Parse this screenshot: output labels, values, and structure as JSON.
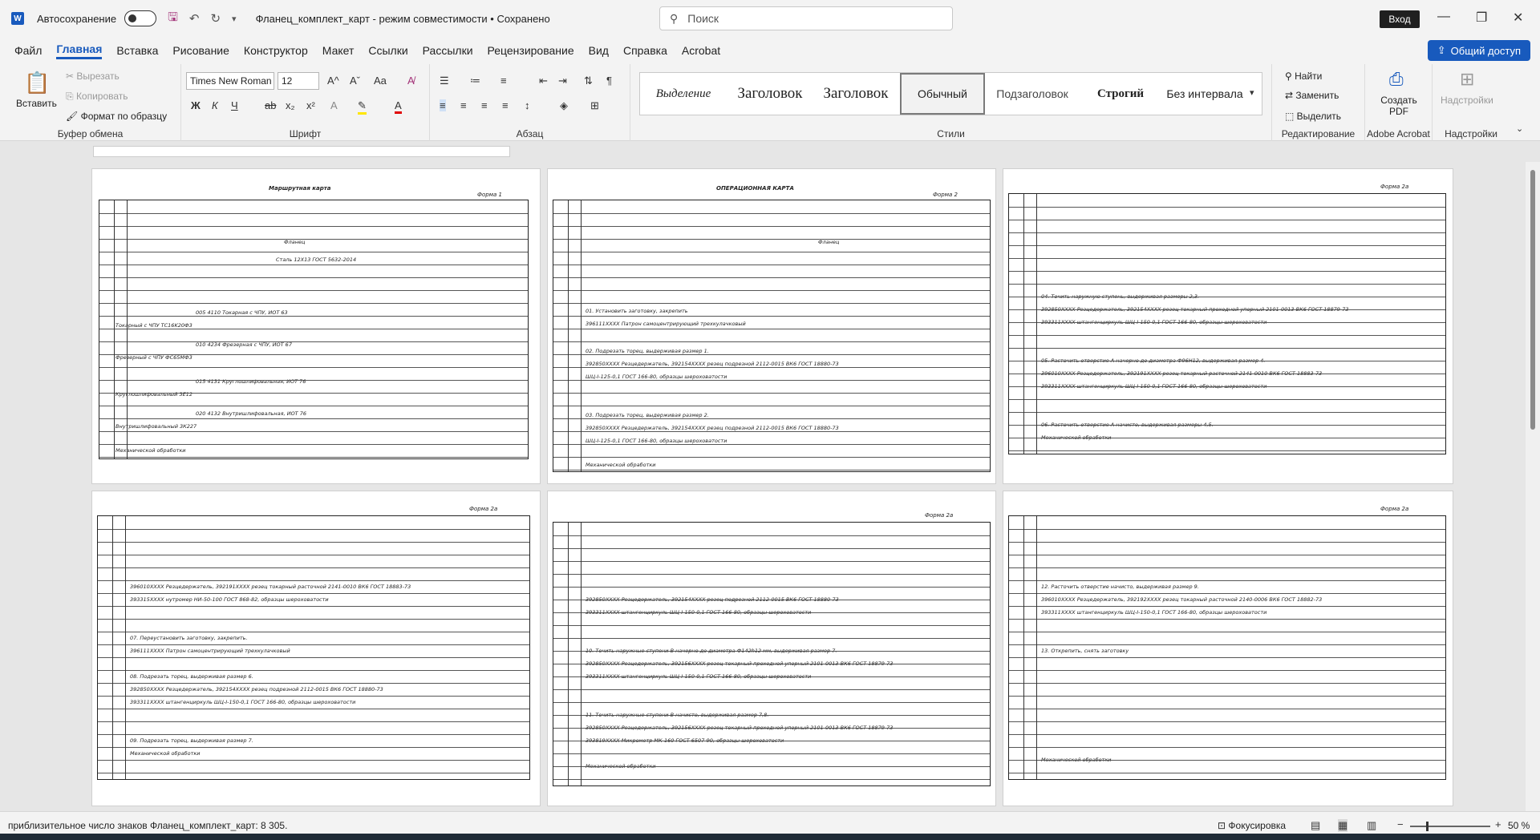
{
  "titlebar": {
    "autosave_label": "Автосохранение",
    "document_title": "Фланец_комплект_карт - режим совместимости • Сохранено",
    "search_placeholder": "Поиск",
    "login_label": "Вход"
  },
  "menu": {
    "items": [
      "Файл",
      "Главная",
      "Вставка",
      "Рисование",
      "Конструктор",
      "Макет",
      "Ссылки",
      "Рассылки",
      "Рецензирование",
      "Вид",
      "Справка",
      "Acrobat"
    ],
    "active": "Главная",
    "share_label": "Общий доступ"
  },
  "ribbon": {
    "clipboard": {
      "paste": "Вставить",
      "cut": "Вырезать",
      "copy": "Копировать",
      "format_painter": "Формат по образцу",
      "group_label": "Буфер обмена"
    },
    "font": {
      "font_name": "Times New Roman",
      "font_size": "12",
      "group_label": "Шрифт"
    },
    "paragraph": {
      "group_label": "Абзац"
    },
    "styles": {
      "items": [
        "Выделение",
        "Заголовок",
        "Заголовок",
        "Обычный",
        "Подзаголовок",
        "Строгий",
        "Без интервала"
      ],
      "group_label": "Стили"
    },
    "editing": {
      "find": "Найти",
      "replace": "Заменить",
      "select": "Выделить",
      "group_label": "Редактирование"
    },
    "acrobat": {
      "create_pdf": "Создать PDF",
      "group_label": "Adobe Acrobat"
    },
    "addins": {
      "label": "Надстройки",
      "group_label": "Надстройки"
    }
  },
  "pages": [
    {
      "title": "Маршрутная карта",
      "form": "Форма 1",
      "part": "Фланец",
      "material": "Сталь 12Х13 ГОСТ 5632-2014",
      "footer": "Механической обработки",
      "rows": [
        "005 4110 Токарная с ЧПУ, ИОТ 63",
        "Токарный с ЧПУ TC16K20Ф3",
        "010 4234 Фрезерная с ЧПУ, ИОТ 67",
        "Фрезерный с ЧПУ ФС65МФ3",
        "015 4131 Круглошлифовальная, ИОТ 76",
        "Круглошлифовальный 3Е12",
        "020 4132 Внутришлифовальная, ИОТ 76",
        "Внутришлифовальный 3К227"
      ]
    },
    {
      "title": "ОПЕРАЦИОННАЯ КАРТА",
      "form": "Форма 2",
      "part": "Фланец",
      "footer": "Механической обработки",
      "rows": [
        "01. Установить заготовку, закрепить",
        "396111XXXX Патрон самоцентрирующий трехкулачковый",
        "02. Подрезать торец, выдерживая размер 1.",
        "392850XXXX Резцедержатель, 392154XXXX резец подрезной 2112-0015 ВК6 ГОСТ 18880-73",
        "ШЦ-I-125-0,1 ГОСТ 166-80, образцы шероховатости",
        "03. Подрезать торец, выдерживая размер 2.",
        "392850XXXX Резцедержатель, 392154XXXX резец подрезной 2112-0015 ВК6 ГОСТ 18880-73",
        "ШЦ-I-125-0,1 ГОСТ 166-80, образцы шероховатости"
      ]
    },
    {
      "form": "Форма 2а",
      "footer": "Механической обработки",
      "rows": [
        "04. Точить наружную ступень, выдерживая размеры 2,3.",
        "392850XXXX Резцедержатель, 392154XXXX резец токарный проходной упорный 2101-0013 ВК6 ГОСТ 18879-73",
        "393311XXXX штангенциркуль ШЦ-I-150-0,1 ГОСТ 166-80, образцы шероховатости",
        "05. Расточить отверстие А начерно до диаметра Ф96Н12, выдерживая размер 4.",
        "396010XXXX Резцедержатель, 392191XXXX резец токарный расточной 2141-0010 ВК6 ГОСТ 18883-73",
        "393311XXXX штангенциркуль ШЦ-I-150-0,1 ГОСТ 166-80, образцы шероховатости",
        "06. Расточить отверстие А начисто, выдерживая размеры 4,5."
      ]
    },
    {
      "form": "Форма 2а",
      "footer": "Механической обработки",
      "rows": [
        "396010XXXX Резцедержатель, 392191XXXX резец токарный расточной 2141-0010 ВК6 ГОСТ 18883-73",
        "393315XXXX нутромер НИ-50-100 ГОСТ 868-82, образцы шероховатости",
        "07. Переустановить заготовку, закрепить.",
        "396111XXXX Патрон самоцентрирующий трехкулачковый",
        "08. Подрезать торец, выдерживая размер 6.",
        "392850XXXX Резцедержатель, 392154XXXX резец подрезной 2112-0015 ВК6 ГОСТ 18880-73",
        "393311XXXX штангенциркуль ШЦ-I-150-0,1 ГОСТ 166-80, образцы шероховатости",
        "09. Подрезать торец, выдерживая размер 7."
      ]
    },
    {
      "form": "Форма 2а",
      "footer": "Механической обработки",
      "rows": [
        "392850XXXX Резцедержатель, 392154XXXX резец подрезной 2112-0015 ВК6 ГОСТ 18880-73",
        "393311XXXX штангенциркуль ШЦ-I-150-0,1 ГОСТ 166-80, образцы шероховатости",
        "10. Точить наружные ступени В начерно до диаметра Ф142h12 мм, выдерживая размер 7.",
        "392850XXXX Резцедержатель, 392156XXXX резец токарный проходной упорный 2101-0013 ВК6 ГОСТ 18879-73",
        "393311XXXX штангенциркуль ШЦ-I-150-0,1 ГОСТ 166-80, образцы шероховатости",
        "11. Точить наружные ступени В начисто, выдерживая размер 7,8.",
        "392850XXXX Резцедержатель, 392156XXXX резец токарный проходной упорный 2101-0013 ВК6 ГОСТ 18879-73",
        "393819XXXX Микрометр МК-160 ГОСТ 6507-90, образцы шероховатости"
      ]
    },
    {
      "form": "Форма 2а",
      "footer": "Механической обработки",
      "rows": [
        "12. Расточить отверстие начисто, выдерживая размер 9.",
        "396010XXXX Резцедержатель, 392192XXXX резец токарный расточной 2140-0006 ВК6 ГОСТ 18882-73",
        "393311XXXX штангенциркуль ШЦ-I-150-0,1 ГОСТ 166-80, образцы шероховатости",
        "13. Открепить, снять заготовку"
      ]
    }
  ],
  "statusbar": {
    "word_count": "приблизительное число знаков Фланец_комплект_карт: 8 305.",
    "focus": "Фокусировка",
    "zoom": "50 %"
  }
}
